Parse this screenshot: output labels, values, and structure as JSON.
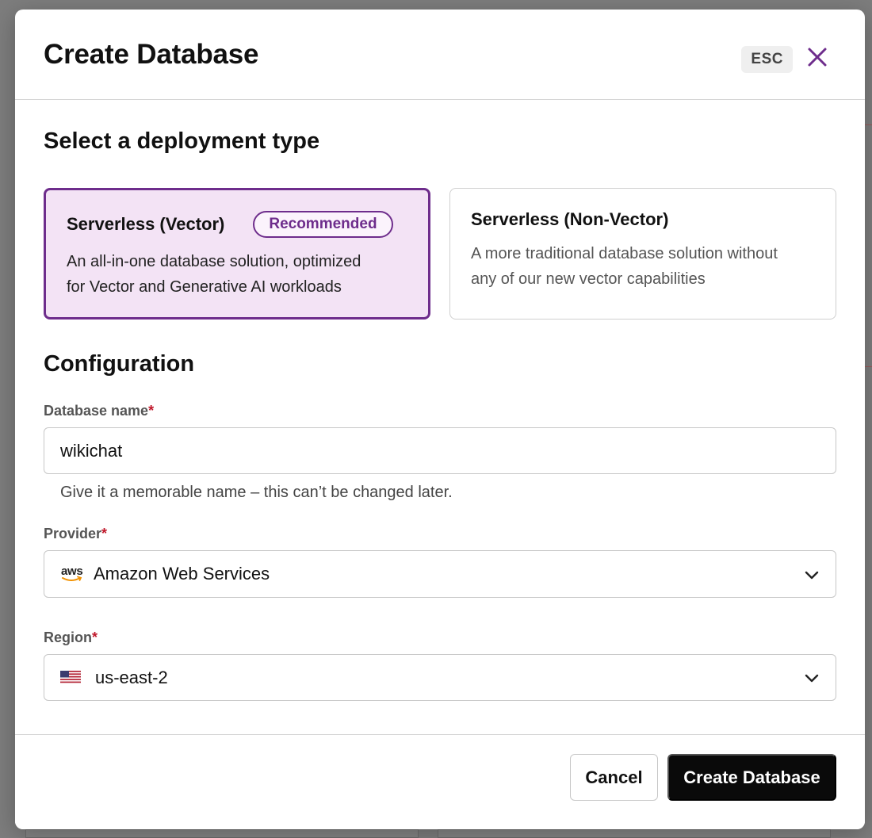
{
  "modal": {
    "title": "Create Database",
    "esc_label": "ESC"
  },
  "deployment": {
    "section_title": "Select a deployment type",
    "options": [
      {
        "title": "Serverless (Vector)",
        "badge": "Recommended",
        "description_line1": "An all-in-one database solution, optimized",
        "description_line2": "for Vector and Generative AI workloads",
        "selected": true
      },
      {
        "title": "Serverless (Non-Vector)",
        "description_line1": "A more traditional database solution without",
        "description_line2": "any of our new vector capabilities",
        "selected": false
      }
    ]
  },
  "configuration": {
    "section_title": "Configuration",
    "database_name": {
      "label": "Database name",
      "required_mark": "*",
      "value": "wikichat",
      "helper": "Give it a memorable name – this can’t be changed later."
    },
    "provider": {
      "label": "Provider",
      "required_mark": "*",
      "value": "Amazon Web Services",
      "logo_text": "aws"
    },
    "region": {
      "label": "Region",
      "required_mark": "*",
      "value": "us-east-2"
    }
  },
  "footer": {
    "cancel_label": "Cancel",
    "create_label": "Create Database"
  },
  "colors": {
    "accent": "#6e2d8c",
    "selected_card_bg": "#f3e3f5",
    "required": "#c0182b",
    "primary_button": "#0a0a0a"
  }
}
